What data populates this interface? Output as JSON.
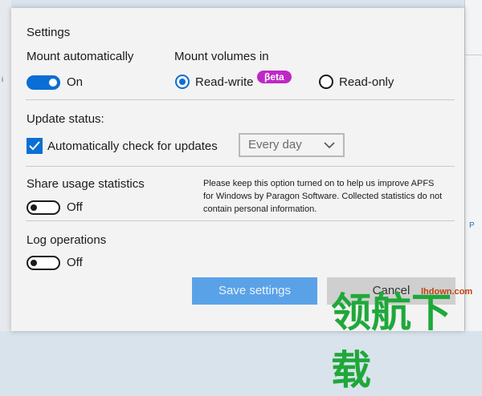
{
  "settings": {
    "heading": "Settings",
    "mount_automatically": {
      "label": "Mount automatically",
      "state_label": "On"
    },
    "mount_volumes_in": {
      "label": "Mount volumes in",
      "options": [
        {
          "label": "Read-write",
          "selected": true,
          "badge": "βeta"
        },
        {
          "label": "Read-only",
          "selected": false
        }
      ]
    },
    "update_status": {
      "label": "Update status:",
      "checkbox_label": "Automatically check for updates",
      "checked": true,
      "frequency": "Every day"
    },
    "share_usage": {
      "label": "Share usage statistics",
      "state_label": "Off",
      "note": "Please keep this option turned on to help us improve APFS for Windows by Paragon Software. Collected statistics do not contain personal information."
    },
    "log_operations": {
      "label": "Log operations",
      "state_label": "Off"
    },
    "buttons": {
      "save": "Save settings",
      "cancel": "Cancel"
    }
  },
  "watermark": {
    "text": "领航下载",
    "url": "lhdown.com"
  },
  "colors": {
    "accent": "#0a6fd4",
    "beta_badge": "#c026c6",
    "primary_button": "#5aa2e8"
  }
}
